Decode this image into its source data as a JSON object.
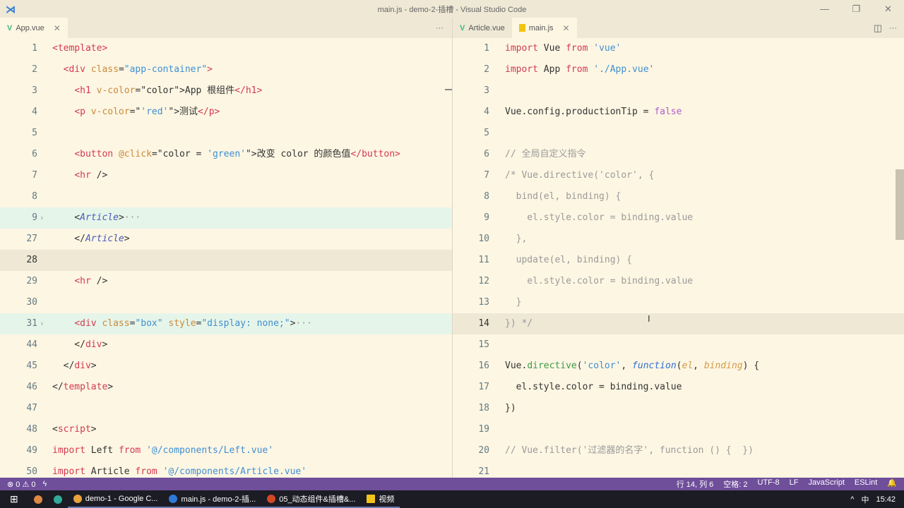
{
  "window": {
    "title": "main.js - demo-2-插槽 - Visual Studio Code",
    "minimize": "—",
    "maximize": "❐",
    "close": "✕"
  },
  "left_tabs": [
    {
      "label": "App.vue",
      "close": "✕"
    }
  ],
  "right_tabs": [
    {
      "label": "Article.vue"
    },
    {
      "label": "main.js",
      "close": "✕"
    }
  ],
  "more": "···",
  "split_icon": "◫",
  "left_editor": {
    "lines": [
      {
        "n": "1",
        "t": [
          [
            "tag",
            "<template>"
          ]
        ]
      },
      {
        "n": "2",
        "t": [
          [
            "",
            "  "
          ],
          [
            "tag",
            "<div "
          ],
          [
            "attr",
            "class"
          ],
          [
            "",
            "="
          ],
          [
            "str",
            "\"app-container\""
          ],
          [
            "tag",
            ">"
          ]
        ]
      },
      {
        "n": "3",
        "t": [
          [
            "",
            "    "
          ],
          [
            "tag",
            "<h1 "
          ],
          [
            "attr",
            "v-color"
          ],
          [
            "",
            "=\"color\">App 根组件"
          ],
          [
            "tag",
            "</h1>"
          ]
        ]
      },
      {
        "n": "4",
        "t": [
          [
            "",
            "    "
          ],
          [
            "tag",
            "<p "
          ],
          [
            "attr",
            "v-color"
          ],
          [
            "",
            "=\""
          ],
          [
            "str",
            "'red'"
          ],
          [
            "",
            "\">测试"
          ],
          [
            "tag",
            "</p>"
          ]
        ]
      },
      {
        "n": "5",
        "t": []
      },
      {
        "n": "6",
        "t": [
          [
            "",
            "    "
          ],
          [
            "tag",
            "<button "
          ],
          [
            "attr",
            "@click"
          ],
          [
            "",
            "=\"color = "
          ],
          [
            "str",
            "'green'"
          ],
          [
            "",
            "\">改变 color 的颜色值"
          ],
          [
            "tag",
            "</button>"
          ]
        ]
      },
      {
        "n": "7",
        "t": [
          [
            "",
            "    "
          ],
          [
            "tag",
            "<hr "
          ],
          [
            "",
            "/>"
          ]
        ]
      },
      {
        "n": "8",
        "t": []
      },
      {
        "n": "9",
        "fold": true,
        "t": [
          [
            "",
            "    <"
          ],
          [
            "comp",
            "Article"
          ],
          [
            "",
            ">"
          ],
          [
            "dim",
            "···"
          ]
        ]
      },
      {
        "n": "27",
        "t": [
          [
            "",
            "    </"
          ],
          [
            "comp",
            "Article"
          ],
          [
            "",
            ">"
          ]
        ]
      },
      {
        "n": "28",
        "cur": true,
        "t": []
      },
      {
        "n": "29",
        "t": [
          [
            "",
            "    "
          ],
          [
            "tag",
            "<hr "
          ],
          [
            "",
            "/>"
          ]
        ]
      },
      {
        "n": "30",
        "t": []
      },
      {
        "n": "31",
        "fold": true,
        "t": [
          [
            "",
            "    "
          ],
          [
            "tag",
            "<div "
          ],
          [
            "attr",
            "class"
          ],
          [
            "",
            "="
          ],
          [
            "str",
            "\"box\" "
          ],
          [
            "attr",
            "style"
          ],
          [
            "",
            "="
          ],
          [
            "str",
            "\"display: none;\""
          ],
          [
            "",
            ">"
          ],
          [
            "dim",
            "···"
          ]
        ]
      },
      {
        "n": "44",
        "t": [
          [
            "",
            "    </"
          ],
          [
            "tag",
            "div"
          ],
          [
            "",
            ">"
          ]
        ]
      },
      {
        "n": "45",
        "t": [
          [
            "",
            "  </"
          ],
          [
            "tag",
            "div"
          ],
          [
            "",
            ">"
          ]
        ]
      },
      {
        "n": "46",
        "t": [
          [
            "",
            "</"
          ],
          [
            "tag",
            "template"
          ],
          [
            "",
            ">"
          ]
        ]
      },
      {
        "n": "47",
        "t": []
      },
      {
        "n": "48",
        "t": [
          [
            "",
            "<"
          ],
          [
            "tag",
            "script"
          ],
          [
            "",
            ">"
          ]
        ]
      },
      {
        "n": "49",
        "t": [
          [
            "kw",
            "import"
          ],
          [
            "",
            " Left "
          ],
          [
            "kw",
            "from"
          ],
          [
            "",
            " "
          ],
          [
            "str",
            "'@/components/Left.vue'"
          ]
        ]
      },
      {
        "n": "50",
        "t": [
          [
            "kw",
            "import"
          ],
          [
            "",
            " Article "
          ],
          [
            "kw",
            "from"
          ],
          [
            "",
            " "
          ],
          [
            "str",
            "'@/components/Article.vue'"
          ]
        ]
      }
    ]
  },
  "right_editor": {
    "lines": [
      {
        "n": "1",
        "t": [
          [
            "kw",
            "import"
          ],
          [
            "",
            " Vue "
          ],
          [
            "kw",
            "from"
          ],
          [
            "",
            " "
          ],
          [
            "str",
            "'vue'"
          ]
        ]
      },
      {
        "n": "2",
        "t": [
          [
            "kw",
            "import"
          ],
          [
            "",
            " App "
          ],
          [
            "kw",
            "from"
          ],
          [
            "",
            " "
          ],
          [
            "str",
            "'./App.vue'"
          ]
        ]
      },
      {
        "n": "3",
        "t": []
      },
      {
        "n": "4",
        "t": [
          [
            "",
            "Vue.config.productionTip = "
          ],
          [
            "num",
            "false"
          ]
        ]
      },
      {
        "n": "5",
        "t": []
      },
      {
        "n": "6",
        "t": [
          [
            "cmt",
            "// 全局自定义指令"
          ]
        ]
      },
      {
        "n": "7",
        "t": [
          [
            "cmt",
            "/* Vue.directive('color', {"
          ]
        ]
      },
      {
        "n": "8",
        "t": [
          [
            "cmt",
            "  bind(el, binding) {"
          ]
        ]
      },
      {
        "n": "9",
        "t": [
          [
            "cmt",
            "    el.style.color = binding.value"
          ]
        ]
      },
      {
        "n": "10",
        "t": [
          [
            "cmt",
            "  },"
          ]
        ]
      },
      {
        "n": "11",
        "t": [
          [
            "cmt",
            "  update(el, binding) {"
          ]
        ]
      },
      {
        "n": "12",
        "t": [
          [
            "cmt",
            "    el.style.color = binding.value"
          ]
        ]
      },
      {
        "n": "13",
        "t": [
          [
            "cmt",
            "  }"
          ]
        ]
      },
      {
        "n": "14",
        "cur": true,
        "t": [
          [
            "cmt",
            "}) */"
          ]
        ]
      },
      {
        "n": "15",
        "t": []
      },
      {
        "n": "16",
        "t": [
          [
            "",
            "Vue."
          ],
          [
            "fn",
            "directive"
          ],
          [
            "",
            "("
          ],
          [
            "str",
            "'color'"
          ],
          [
            "",
            ", "
          ],
          [
            "it",
            "function"
          ],
          [
            "",
            "("
          ],
          [
            "par",
            "el"
          ],
          [
            "",
            ", "
          ],
          [
            "par",
            "binding"
          ],
          [
            "",
            ") {"
          ]
        ]
      },
      {
        "n": "17",
        "t": [
          [
            "",
            "  el.style.color = binding.value"
          ]
        ]
      },
      {
        "n": "18",
        "t": [
          [
            "",
            "})"
          ]
        ]
      },
      {
        "n": "19",
        "t": []
      },
      {
        "n": "20",
        "t": [
          [
            "cmt",
            "// Vue.filter('过滤器的名字', function () {  })"
          ]
        ]
      },
      {
        "n": "21",
        "t": []
      }
    ]
  },
  "status": {
    "errors": "⊗ 0",
    "warnings": "⚠ 0",
    "bolt": "ϟ",
    "position": "行 14, 列 6",
    "spaces": "空格: 2",
    "encoding": "UTF-8",
    "eol": "LF",
    "lang": "JavaScript",
    "lint": "ESLint",
    "bell": "🔔"
  },
  "taskbar": {
    "items": [
      {
        "label": "demo-1 - Google C...",
        "color": "#e8a33d"
      },
      {
        "label": "main.js - demo-2-插...",
        "color": "#2f7ad8"
      },
      {
        "label": "05_动态组件&插槽&...",
        "color": "#d24726"
      },
      {
        "label": "视频",
        "color": "#f0c419"
      }
    ],
    "ime": "中",
    "time": "15:42"
  }
}
